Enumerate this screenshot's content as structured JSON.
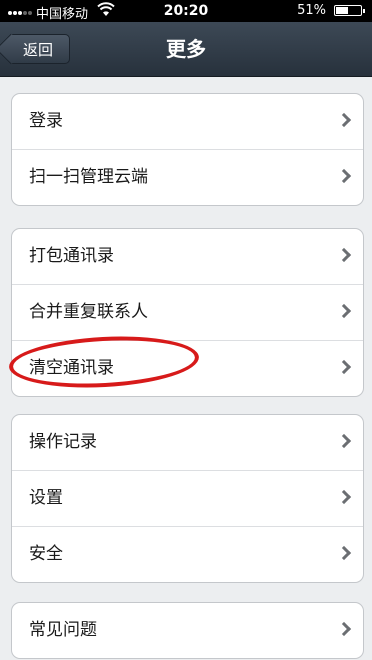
{
  "status_bar": {
    "carrier": "中国移动",
    "time": "20:20",
    "battery_text": "51%",
    "battery_level": 0.51
  },
  "nav": {
    "back_label": "返回",
    "title": "更多"
  },
  "groups": [
    {
      "items": [
        "登录",
        "扫一扫管理云端"
      ]
    },
    {
      "items": [
        "打包通讯录",
        "合并重复联系人",
        "清空通讯录"
      ]
    },
    {
      "items": [
        "操作记录",
        "设置",
        "安全"
      ]
    },
    {
      "items": [
        "常见问题"
      ]
    }
  ],
  "colors": {
    "annotation": "#d71a1a",
    "nav_bar": "#2f3a46"
  },
  "icons": {
    "row_chevron": "chevron-right-icon"
  }
}
